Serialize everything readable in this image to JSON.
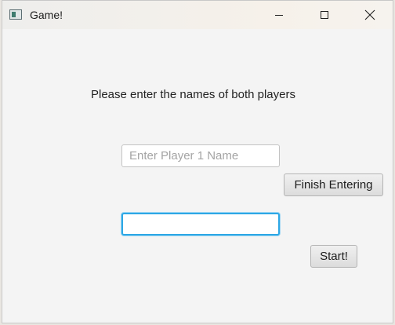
{
  "window": {
    "title": "Game!",
    "icons": {
      "app": "app-window-icon",
      "minimize": "minimize-icon",
      "maximize": "maximize-icon",
      "close": "close-icon"
    }
  },
  "form": {
    "prompt": "Please enter the names of both players",
    "player1": {
      "placeholder": "Enter Player 1 Name",
      "value": ""
    },
    "player2": {
      "placeholder": "",
      "value": "",
      "focused": true
    },
    "finish_label": "Finish Entering",
    "start_label": "Start!"
  },
  "colors": {
    "focus_ring": "#2da7e5",
    "window_bg": "#f4f4f4"
  }
}
